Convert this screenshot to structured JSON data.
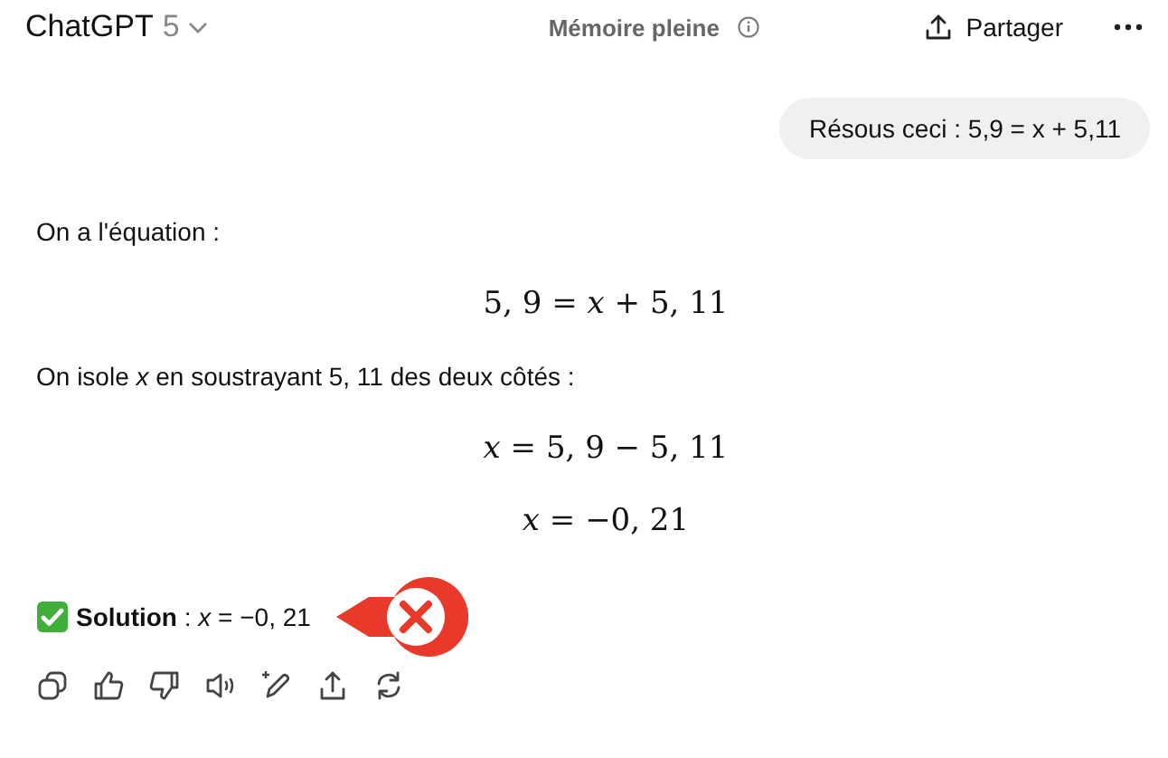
{
  "header": {
    "title": "ChatGPT",
    "version": "5",
    "memory_status": "Mémoire pleine",
    "share_label": "Partager"
  },
  "user_message": "Résous ceci : 5,9 = x + 5,11",
  "response": [
    {
      "kind": "text",
      "text": "On a l'équation :"
    },
    {
      "kind": "equation",
      "text": "5, 9 = *x* + 5, 11"
    },
    {
      "kind": "text",
      "text": "On isole *x* en soustrayant 5, 11 des deux côtés :"
    },
    {
      "kind": "equation",
      "text": "*x* = 5, 9 − 5, 11"
    },
    {
      "kind": "equation",
      "text": "*x* = −0, 21"
    },
    {
      "kind": "solution",
      "text": "**Solution** : *x* = −0, 21",
      "flagged_wrong": true
    }
  ]
}
